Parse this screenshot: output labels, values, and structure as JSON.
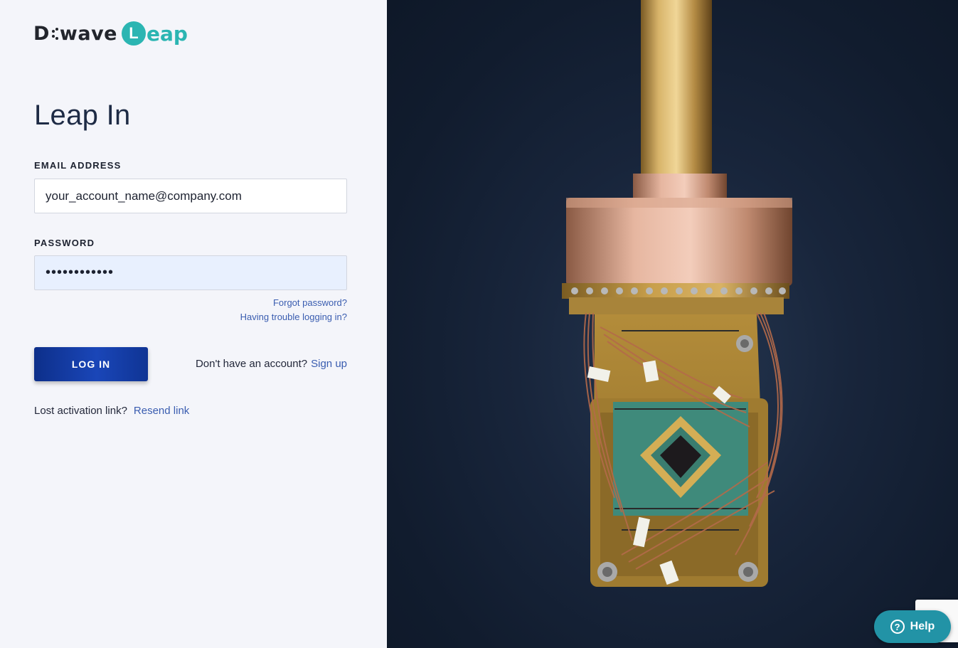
{
  "logo": {
    "brand": "D-Wave",
    "product": "Leap",
    "dwave_text": "D",
    "wave_text": "wave",
    "leap_l": "L",
    "leap_rest": "eap"
  },
  "page": {
    "title": "Leap In"
  },
  "email": {
    "label": "EMAIL ADDRESS",
    "value": "your_account_name@company.com"
  },
  "password": {
    "label": "PASSWORD",
    "value": "••••••••••••"
  },
  "links": {
    "forgot": "Forgot password?",
    "trouble": "Having trouble logging in?"
  },
  "login": {
    "label": "LOG IN"
  },
  "signup": {
    "prompt": "Don't have an account?",
    "link": "Sign up"
  },
  "resend": {
    "prompt": "Lost activation link?",
    "link": "Resend link"
  },
  "help": {
    "label": "Help"
  },
  "colors": {
    "accent": "#2bb5b2",
    "primary": "#1a46b8",
    "link": "#3a5db0",
    "help": "#2293a6",
    "copper": "#c88a6a",
    "gold": "#c7a049"
  }
}
